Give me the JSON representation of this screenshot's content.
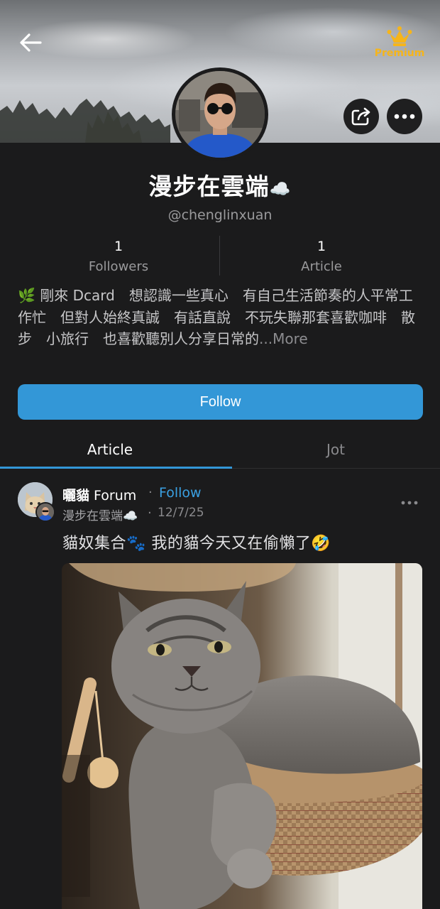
{
  "header": {
    "premium_label": "Premium",
    "back_icon": "arrow-left-icon",
    "share_icon": "share-icon",
    "more_icon": "more-horizontal-icon"
  },
  "profile": {
    "display_name": "漫步在雲端",
    "name_emoji": "☁️",
    "handle": "@chenglinxuan",
    "stats": {
      "followers_count": "1",
      "followers_label": "Followers",
      "articles_count": "1",
      "articles_label": "Article"
    },
    "bio_emoji": "🌿",
    "bio_text": " 剛來 Dcard　想認識一些真心　有自己生活節奏的人平常工作忙　但對人始終真誠　有話直說　不玩失聯那套喜歡咖啡　散步　小旅行　也喜歡聽別人分享日常的",
    "bio_more": "...More",
    "follow_label": "Follow"
  },
  "tabs": [
    {
      "label": "Article",
      "active": true
    },
    {
      "label": "Jot",
      "active": false
    }
  ],
  "post": {
    "forum_name_bold": "曬貓",
    "forum_name_rest": " Forum",
    "separator": "·",
    "follow_label": "Follow",
    "author": "漫步在雲端☁️",
    "date": "12/7/25",
    "title": "貓奴集合🐾 我的貓今天又在偷懶了🤣"
  },
  "colors": {
    "background": "#1b1b1c",
    "accent_blue": "#3397d7",
    "premium_gold": "#f6b51a",
    "muted_text": "#9a9a9c"
  }
}
